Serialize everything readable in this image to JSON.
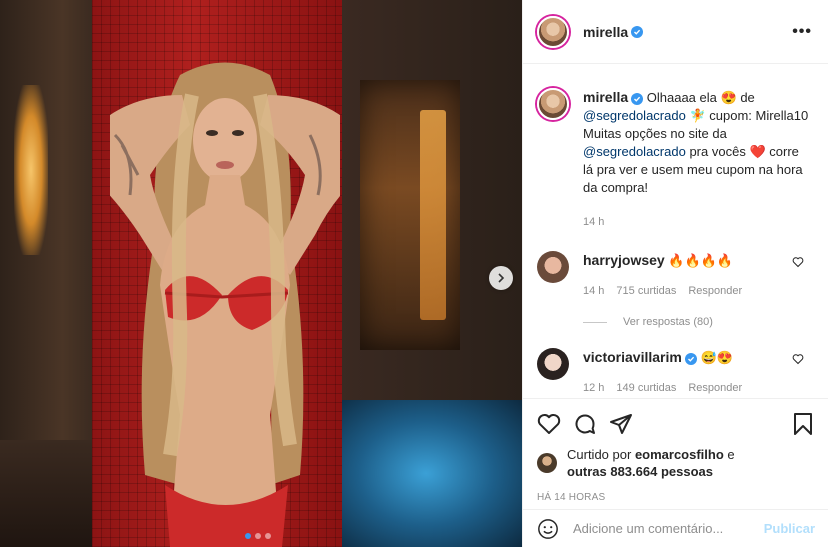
{
  "post": {
    "author": "mirella",
    "image_alt_icons": {
      "next": "chevron-right-icon"
    },
    "carousel": {
      "count": 3,
      "active": 1
    }
  },
  "header": {
    "username": "mirella",
    "more_label": "•••"
  },
  "caption": {
    "username": "mirella",
    "part1": "Olhaaaa ela",
    "emoji1": "😍",
    "part2": "de",
    "mention1": "@segredolacrado",
    "emoji2": "🧚",
    "part3": "cupom: Mirella10",
    "line2": "Muitas opções no site da",
    "mention2": "@segredolacrado",
    "part4": "pra vocês",
    "emoji3": "❤️",
    "part5": "corre lá pra ver e usem meu cupom na hora da compra!",
    "time": "14 h"
  },
  "comments": [
    {
      "username": "harryjowsey",
      "verified": false,
      "text": "🔥🔥🔥🔥",
      "time": "14 h",
      "likes": "715 curtidas",
      "reply": "Responder",
      "view_replies": "Ver respostas (80)"
    },
    {
      "username": "victoriavillarim",
      "verified": true,
      "text": "😅😍",
      "time": "12 h",
      "likes": "149 curtidas",
      "reply": "Responder"
    }
  ],
  "likes": {
    "prefix": "Curtido por",
    "user": "eomarcosfilho",
    "middle": "e",
    "others": "outras 883.664 pessoas"
  },
  "posted_ago": "HÁ 14 HORAS",
  "comment_box": {
    "placeholder": "Adicione um comentário...",
    "publish": "Publicar"
  },
  "colors": {
    "verified": "#3897f0",
    "mention": "#00376b",
    "publish_disabled": "#b2dffc"
  }
}
